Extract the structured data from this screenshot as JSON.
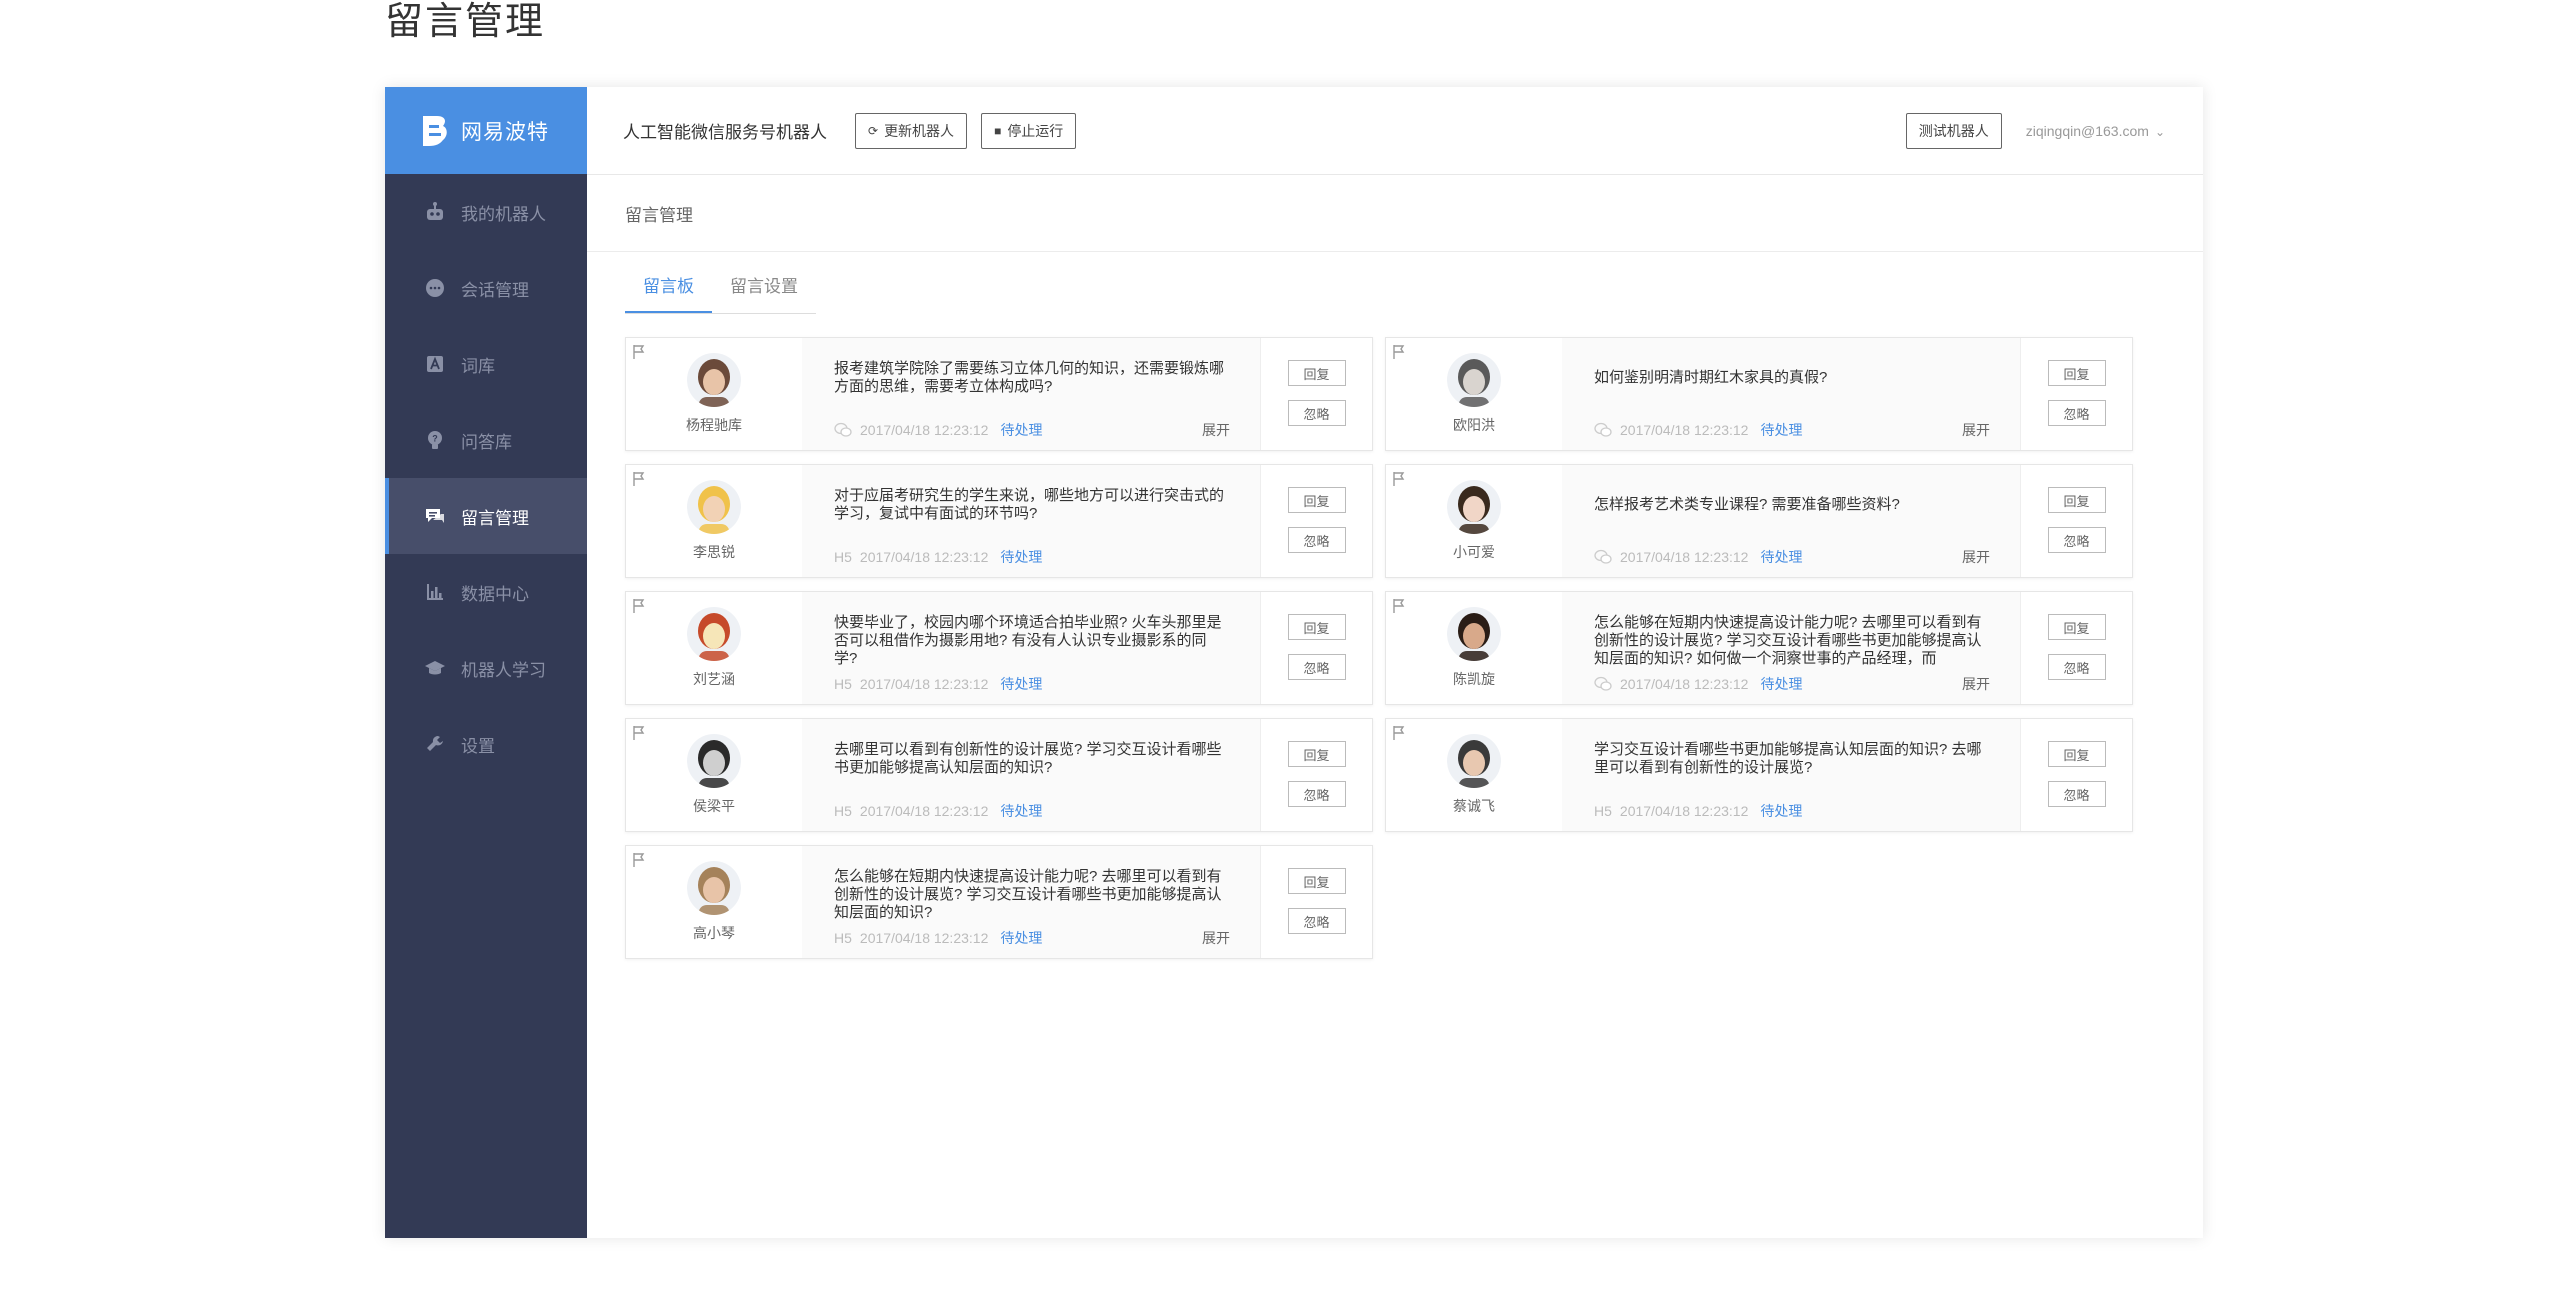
{
  "page_heading": "留言管理",
  "colors": {
    "accent": "#4a8fe2",
    "sidebar_bg": "#333a55",
    "status": "#4a8fe2"
  },
  "sidebar": {
    "brand": "网易波特",
    "items": [
      {
        "label": "我的机器人",
        "icon": "robot-icon"
      },
      {
        "label": "会话管理",
        "icon": "chat-icon"
      },
      {
        "label": "词库",
        "icon": "lexicon-icon"
      },
      {
        "label": "问答库",
        "icon": "bulb-icon"
      },
      {
        "label": "留言管理",
        "icon": "message-icon",
        "active": true
      },
      {
        "label": "数据中心",
        "icon": "bar-chart-icon"
      },
      {
        "label": "机器人学习",
        "icon": "graduation-cap-icon"
      },
      {
        "label": "设置",
        "icon": "wrench-icon"
      }
    ]
  },
  "topbar": {
    "bot_name": "人工智能微信服务号机器人",
    "refresh_label": "更新机器人",
    "stop_label": "停止运行",
    "test_label": "测试机器人",
    "user_email": "ziqingqin@163.com"
  },
  "breadcrumb": "留言管理",
  "tabs": [
    {
      "label": "留言板",
      "active": true
    },
    {
      "label": "留言设置",
      "active": false
    }
  ],
  "labels": {
    "reply": "回复",
    "ignore": "忽略",
    "expand": "展开"
  },
  "messages": [
    {
      "user": "杨程驰库",
      "text": "报考建筑学院除了需要练习立体几何的知识，还需要锻炼哪方面的思维，需要考立体构成吗?",
      "source": "wechat",
      "time": "2017/04/18 12:23:12",
      "status": "待处理",
      "expand": "展开"
    },
    {
      "user": "欧阳洪",
      "text": "如何鉴别明清时期红木家具的真假?",
      "source": "wechat",
      "time": "2017/04/18 12:23:12",
      "status": "待处理",
      "expand": "展开"
    },
    {
      "user": "李思锐",
      "text": "对于应届考研究生的学生来说，哪些地方可以进行突击式的学习，复试中有面试的环节吗?",
      "source": "H5",
      "time": "2017/04/18 12:23:12",
      "status": "待处理",
      "expand": ""
    },
    {
      "user": "小可爱",
      "text": "怎样报考艺术类专业课程? 需要准备哪些资料?",
      "source": "wechat",
      "time": "2017/04/18 12:23:12",
      "status": "待处理",
      "expand": "展开"
    },
    {
      "user": "刘艺涵",
      "text": "快要毕业了，校园内哪个环境适合拍毕业照? 火车头那里是否可以租借作为摄影用地? 有没有人认识专业摄影系的同学?",
      "source": "H5",
      "time": "2017/04/18 12:23:12",
      "status": "待处理",
      "expand": ""
    },
    {
      "user": "陈凯旋",
      "text": "怎么能够在短期内快速提高设计能力呢? 去哪里可以看到有创新性的设计展览? 学习交互设计看哪些书更加能够提高认知层面的知识? 如何做一个洞察世事的产品经理，而",
      "source": "wechat",
      "time": "2017/04/18 12:23:12",
      "status": "待处理",
      "expand": "展开"
    },
    {
      "user": "侯梁平",
      "text": "去哪里可以看到有创新性的设计展览? 学习交互设计看哪些书更加能够提高认知层面的知识?",
      "source": "H5",
      "time": "2017/04/18 12:23:12",
      "status": "待处理",
      "expand": ""
    },
    {
      "user": "蔡诚飞",
      "text": "学习交互设计看哪些书更加能够提高认知层面的知识? 去哪里可以看到有创新性的设计展览?",
      "source": "H5",
      "time": "2017/04/18 12:23:12",
      "status": "待处理",
      "expand": ""
    },
    {
      "user": "高小琴",
      "text": "怎么能够在短期内快速提高设计能力呢? 去哪里可以看到有创新性的设计展览? 学习交互设计看哪些书更加能够提高认知层面的知识?",
      "source": "H5",
      "time": "2017/04/18 12:23:12",
      "status": "待处理",
      "expand": "展开"
    }
  ]
}
